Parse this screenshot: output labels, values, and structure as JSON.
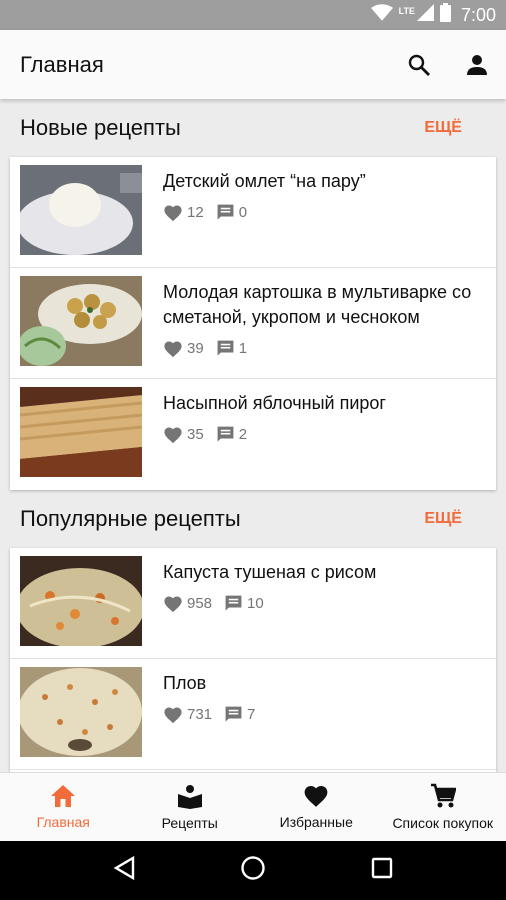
{
  "status_bar": {
    "network": "LTE",
    "time": "7:00"
  },
  "app_bar": {
    "title": "Главная"
  },
  "sections": [
    {
      "title": "Новые рецепты",
      "more_label": "ЕЩЁ",
      "recipes": [
        {
          "title": "Детский омлет “на пару”",
          "likes": "12",
          "comments": "0"
        },
        {
          "title": "Молодая картошка в мультиварке со сметаной, укропом и чесноком",
          "likes": "39",
          "comments": "1"
        },
        {
          "title": "Насыпной яблочный пирог",
          "likes": "35",
          "comments": "2"
        }
      ]
    },
    {
      "title": "Популярные рецепты",
      "more_label": "ЕЩЁ",
      "recipes": [
        {
          "title": "Капуста тушеная с рисом",
          "likes": "958",
          "comments": "10"
        },
        {
          "title": "Плов",
          "likes": "731",
          "comments": "7"
        }
      ]
    }
  ],
  "bottom_nav": [
    {
      "label": "Главная",
      "icon": "home-icon",
      "active": true
    },
    {
      "label": "Рецепты",
      "icon": "book-icon",
      "active": false
    },
    {
      "label": "Избранные",
      "icon": "heart-icon",
      "active": false
    },
    {
      "label": "Список покупок",
      "icon": "cart-icon",
      "active": false
    }
  ],
  "colors": {
    "accent": "#f26b3a",
    "status_bar": "#9e9e9e",
    "background": "#ececec"
  }
}
